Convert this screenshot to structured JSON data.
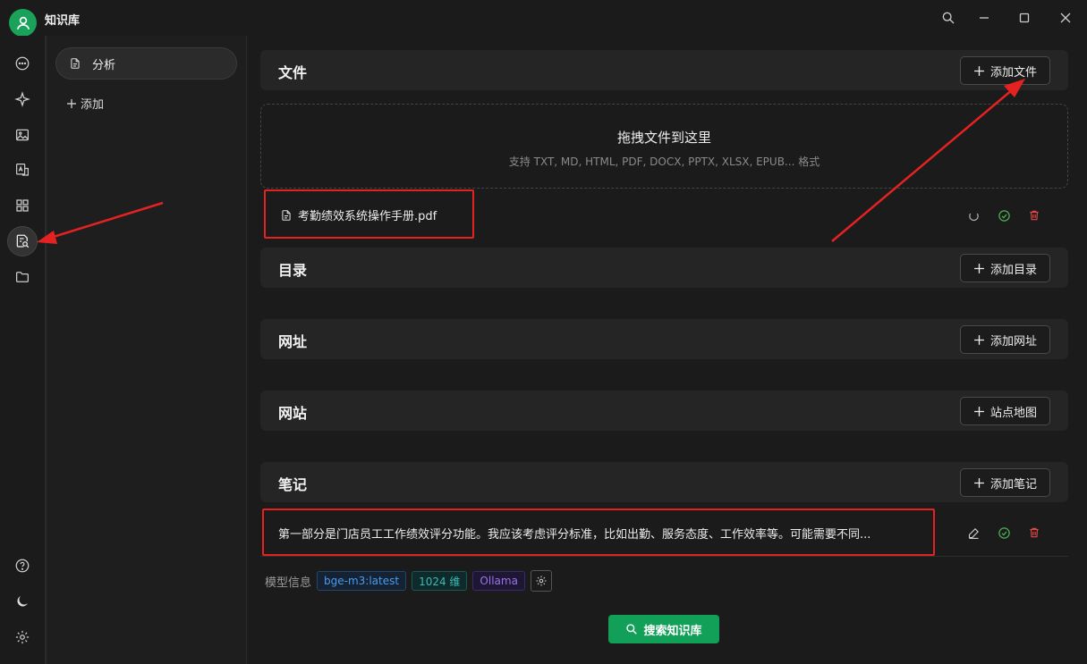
{
  "window": {
    "title": "知识库"
  },
  "icons": {
    "avatar": "user-icon",
    "search": "search-icon",
    "minimize": "minimize-icon",
    "maximize": "maximize-icon",
    "close": "close-icon"
  },
  "rail": {
    "items": [
      "chat-icon",
      "sparkle-icon",
      "image-icon",
      "translate-icon",
      "apps-icon",
      "knowledge-icon",
      "folder-icon"
    ],
    "active": "knowledge-icon",
    "bottom": [
      "help-icon",
      "moon-icon",
      "gear-icon"
    ]
  },
  "sidebar": {
    "knowledge_bases": [
      {
        "label": "分析"
      }
    ],
    "add_label": "添加"
  },
  "sections": {
    "files": {
      "title": "文件",
      "button": "添加文件"
    },
    "directory": {
      "title": "目录",
      "button": "添加目录"
    },
    "url": {
      "title": "网址",
      "button": "添加网址"
    },
    "website": {
      "title": "网站",
      "button": "站点地图"
    },
    "notes": {
      "title": "笔记",
      "button": "添加笔记"
    }
  },
  "dropzone": {
    "title": "拖拽文件到这里",
    "subtitle": "支持 TXT, MD, HTML, PDF, DOCX, PPTX, XLSX, EPUB... 格式"
  },
  "files": [
    {
      "name": "考勤绩效系统操作手册.pdf"
    }
  ],
  "notes": [
    {
      "text": "第一部分是门店员工工作绩效评分功能。我应该考虑评分标准，比如出勤、服务态度、工作效率等。可能需要不同..."
    }
  ],
  "model_info": {
    "label": "模型信息",
    "model": "bge-m3:latest",
    "dimensions": "1024 维",
    "provider": "Ollama"
  },
  "search_button": "搜索知识库",
  "colors": {
    "accent": "#12a058",
    "annotation": "#e52222",
    "success": "#4caf50",
    "danger": "#e04848"
  }
}
